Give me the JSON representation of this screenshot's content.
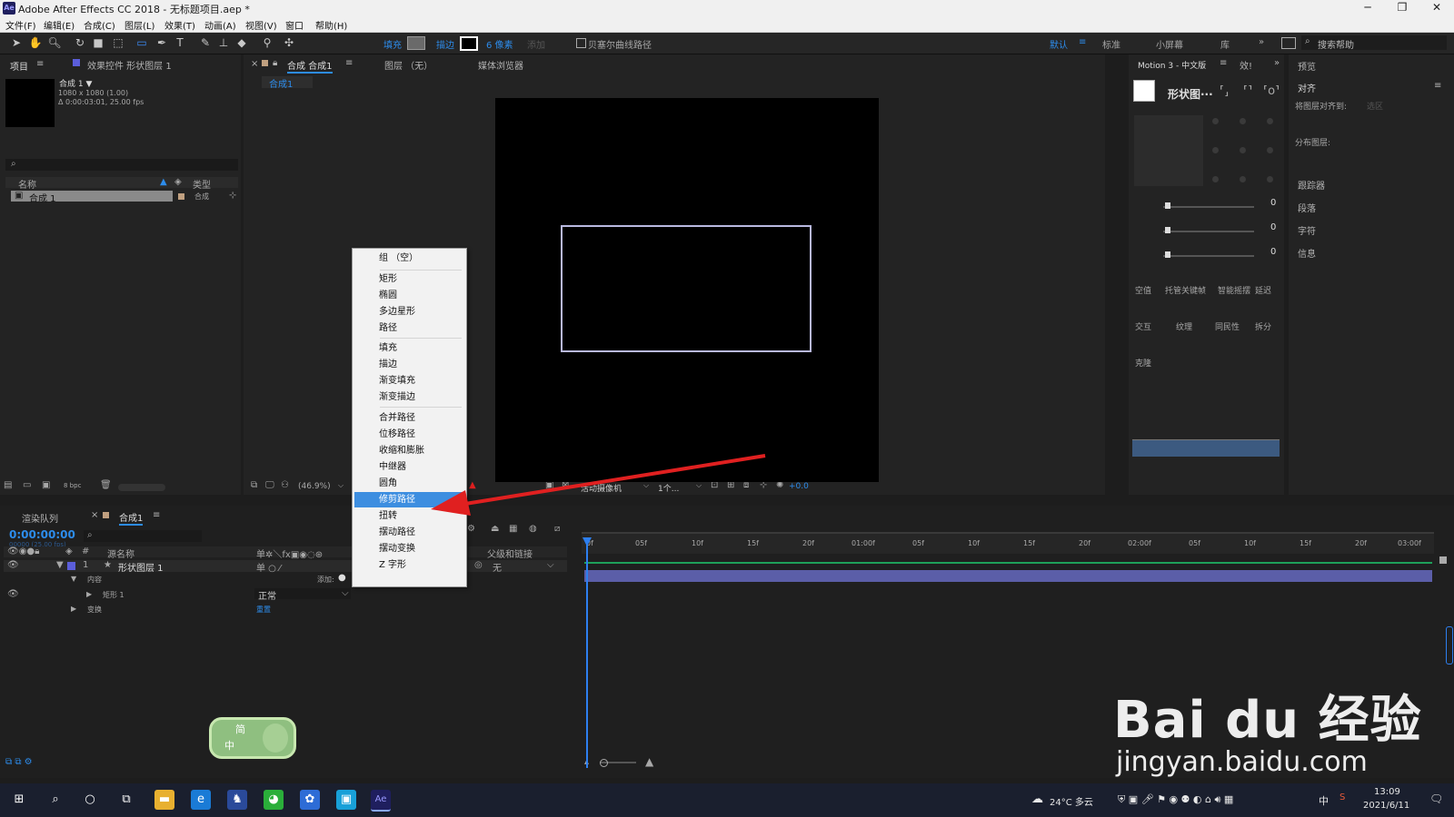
{
  "titlebar": {
    "title": "Adobe After Effects CC 2018 - 无标题项目.aep *",
    "app_icon": "Ae",
    "min": "─",
    "max": "❐",
    "close": "✕"
  },
  "menubar": [
    "文件(F)",
    "编辑(E)",
    "合成(C)",
    "图层(L)",
    "效果(T)",
    "动画(A)",
    "视图(V)",
    "窗口",
    "帮助(H)"
  ],
  "toolbar": {
    "fill_label": "填充",
    "stroke_label": "描边",
    "stroke_width": "6 像素",
    "add_label": "添加",
    "bezier_label": "贝塞尔曲线路径",
    "workspaces": [
      "默认",
      "标准",
      "小屏幕",
      "库"
    ],
    "search_placeholder": "搜索帮助"
  },
  "project": {
    "tab_project": "项目",
    "tab_effects": "效果控件 形状图层 1",
    "comp_name": "合成 1 ▼",
    "comp_size": "1080 x 1080 (1.00)",
    "comp_duration": "Δ 0:00:03:01, 25.00 fps",
    "col_name": "名称",
    "col_type": "类型",
    "item_name": "合成 1",
    "item_type": "合成",
    "bpc": "8 bpc"
  },
  "comp_panel": {
    "tab_comp": "合成 合成1",
    "tab_layer": "图层 （无）",
    "tab_footage": "媒体浏览器",
    "sub_tab": "合成1",
    "zoom": "(46.9%)",
    "camera": "活动摄像机",
    "views": "1个...",
    "exposure": "+0.0"
  },
  "context_menu": {
    "items": [
      {
        "label": "组 （空）",
        "highlight": false
      },
      {
        "label": "矩形",
        "highlight": false
      },
      {
        "label": "椭圆",
        "highlight": false
      },
      {
        "label": "多边星形",
        "highlight": false
      },
      {
        "label": "路径",
        "highlight": false
      },
      {
        "label": "填充",
        "highlight": false
      },
      {
        "label": "描边",
        "highlight": false
      },
      {
        "label": "渐变填充",
        "highlight": false
      },
      {
        "label": "渐变描边",
        "highlight": false
      },
      {
        "label": "合并路径",
        "highlight": false
      },
      {
        "label": "位移路径",
        "highlight": false
      },
      {
        "label": "收缩和膨胀",
        "highlight": false
      },
      {
        "label": "中继器",
        "highlight": false
      },
      {
        "label": "圆角",
        "highlight": false
      },
      {
        "label": "修剪路径",
        "highlight": true
      },
      {
        "label": "扭转",
        "highlight": false
      },
      {
        "label": "摆动路径",
        "highlight": false
      },
      {
        "label": "摆动变换",
        "highlight": false
      },
      {
        "label": "Z 字形",
        "highlight": false
      }
    ]
  },
  "motion_panel": {
    "tab": "Motion 3 - 中文版",
    "tab2": "效!",
    "shape_label": "形状图···",
    "sliders": [
      "0",
      "0",
      "0"
    ],
    "buttons": [
      "空值",
      "托管关键帧",
      "智能摇摆",
      "延迟",
      "交互",
      "纹理",
      "同民性",
      "拆分",
      "克隆"
    ]
  },
  "align_panel": {
    "preview": "预览",
    "align": "对齐",
    "align_to": "将图层对齐到:",
    "align_to_value": "选区",
    "distribute": "分布图层:",
    "tracker": "跟踪器",
    "paragraph": "段落",
    "character": "字符",
    "info": "信息"
  },
  "timeline": {
    "tab_render": "渲染队列",
    "tab_comp": "合成1",
    "timecode": "0:00:00:00",
    "timecode_sub": "00000 (25.00 fps)",
    "col_num": "#",
    "col_source": "源名称",
    "col_parent": "父级和链接",
    "layer_num": "1",
    "layer_name": "形状图层 1",
    "contents": "内容",
    "add_label": "添加:",
    "rect_name": "矩形 1",
    "blend_mode": "正常",
    "transform": "变换",
    "reset": "重置",
    "parent_value": "无",
    "ruler_labels": [
      "0f",
      "05f",
      "10f",
      "15f",
      "20f",
      "01:00f",
      "05f",
      "10f",
      "15f",
      "20f",
      "02:00f",
      "05f",
      "10f",
      "15f",
      "20f",
      "03:00f"
    ]
  },
  "taskbar": {
    "weather": "24°C 多云",
    "ime": "中",
    "time": "13:09",
    "date": "2021/6/11"
  },
  "ime_badge": {
    "line1": "简",
    "line2": "中"
  },
  "watermark": {
    "main": "Bai du 经验",
    "sub": "jingyan.baidu.com"
  },
  "colors": {
    "accent": "#2d8ceb",
    "menu_highlight": "#3d8ee0",
    "layer_bar": "#5b5ea8",
    "arrow": "#e02020",
    "shape_stroke": "#b9b9e0"
  }
}
